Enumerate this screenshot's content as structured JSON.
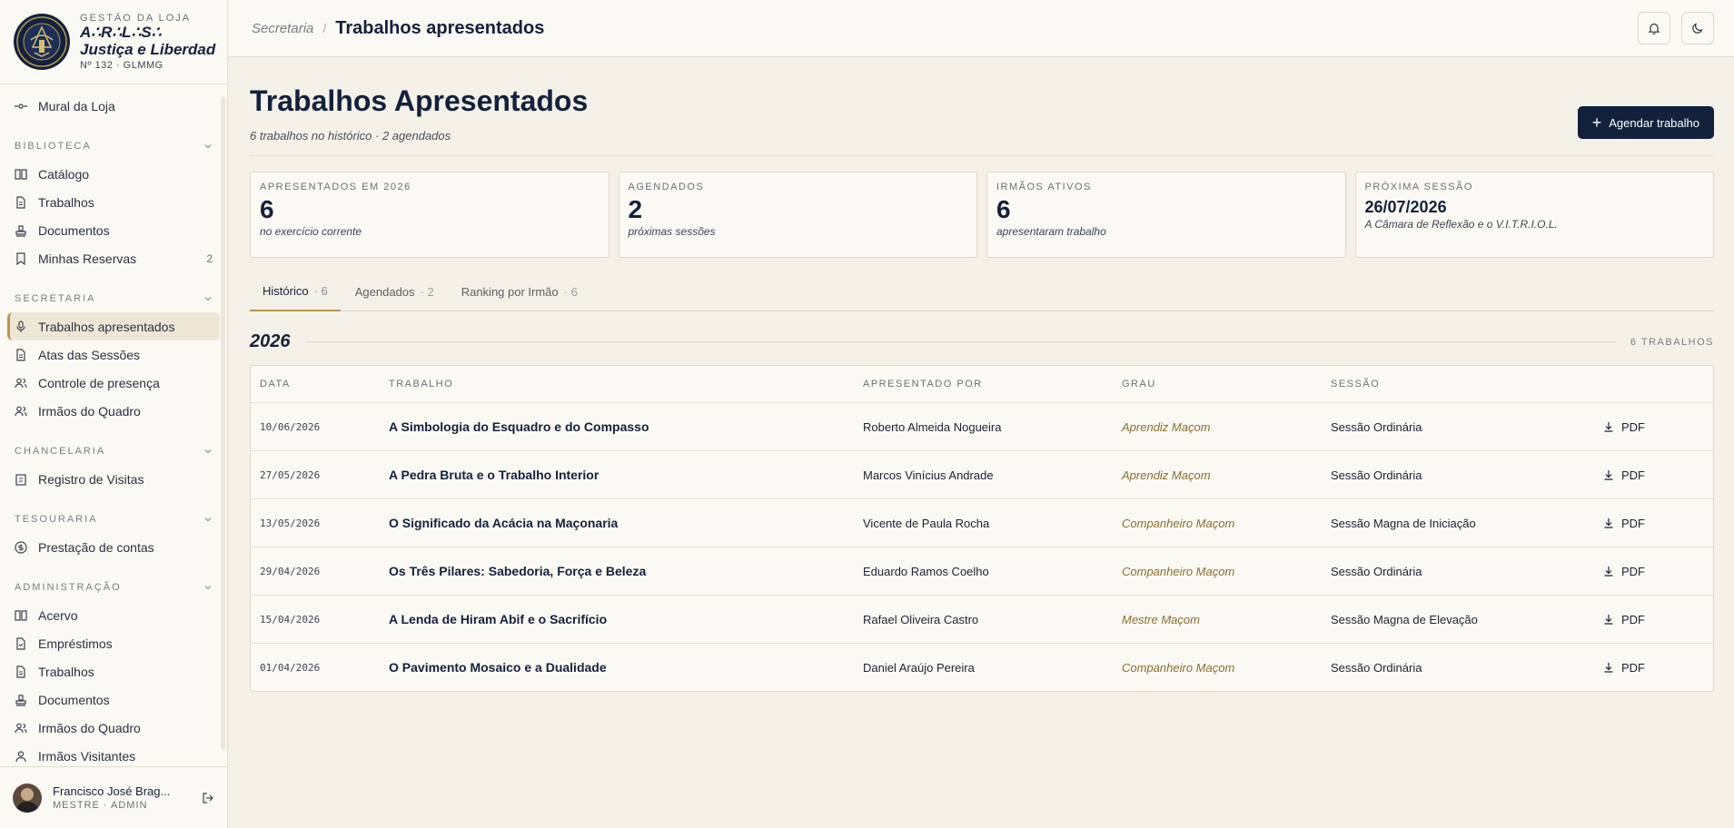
{
  "brand": {
    "kicker": "GESTÃO DA LOJA",
    "line1": "A∴R∴L∴S∴",
    "line2": "Justiça e Liberdade",
    "number": "Nº 132 · GLMMG"
  },
  "nav": {
    "mural": "Mural da Loja",
    "sections": {
      "biblioteca": "BIBLIOTECA",
      "secretaria": "SECRETARIA",
      "chancelaria": "CHANCELARIA",
      "tesouraria": "TESOURARIA",
      "administracao": "ADMINISTRAÇÃO"
    },
    "biblioteca": {
      "catalogo": "Catálogo",
      "trabalhos": "Trabalhos",
      "documentos": "Documentos",
      "reservas": "Minhas Reservas",
      "reservas_count": "2"
    },
    "secretaria": {
      "trabalhos": "Trabalhos apresentados",
      "atas": "Atas das Sessões",
      "presenca": "Controle de presença",
      "irmaos": "Irmãos do Quadro"
    },
    "chancelaria": {
      "visitas": "Registro de Visitas"
    },
    "tesouraria": {
      "contas": "Prestação de contas"
    },
    "administracao": {
      "acervo": "Acervo",
      "emprestimos": "Empréstimos",
      "trabalhos": "Trabalhos",
      "documentos": "Documentos",
      "irmaos": "Irmãos do Quadro",
      "visitantes": "Irmãos Visitantes"
    }
  },
  "user": {
    "name": "Francisco José Brag...",
    "role": "MESTRE · ADMIN"
  },
  "topbar": {
    "parent": "Secretaria",
    "separator": "/",
    "current": "Trabalhos apresentados"
  },
  "page": {
    "title": "Trabalhos Apresentados",
    "subtitle": "6 trabalhos no histórico · 2 agendados",
    "action": "Agendar trabalho"
  },
  "stats": [
    {
      "label": "APRESENTADOS EM 2026",
      "value": "6",
      "note": "no exercício corrente"
    },
    {
      "label": "AGENDADOS",
      "value": "2",
      "note": "próximas sessões"
    },
    {
      "label": "IRMÃOS ATIVOS",
      "value": "6",
      "note": "apresentaram trabalho"
    },
    {
      "label": "PRÓXIMA SESSÃO",
      "value": "26/07/2026",
      "note": "A Câmara de Reflexão e o V.I.T.R.I.O.L."
    }
  ],
  "tabs": [
    {
      "label": "Histórico",
      "count": "· 6"
    },
    {
      "label": "Agendados",
      "count": "· 2"
    },
    {
      "label": "Ranking por Irmão",
      "count": "· 6"
    }
  ],
  "group": {
    "year": "2026",
    "count": "6 TRABALHOS"
  },
  "table": {
    "headers": {
      "date": "DATA",
      "title": "TRABALHO",
      "by": "APRESENTADO POR",
      "grau": "GRAU",
      "sessao": "SESSÃO"
    },
    "pdf_label": "PDF",
    "rows": [
      {
        "date": "10/06/2026",
        "title": "A Simbologia do Esquadro e do Compasso",
        "by": "Roberto Almeida Nogueira",
        "grau": "Aprendiz Maçom",
        "sessao": "Sessão Ordinária"
      },
      {
        "date": "27/05/2026",
        "title": "A Pedra Bruta e o Trabalho Interior",
        "by": "Marcos Vinícius Andrade",
        "grau": "Aprendiz Maçom",
        "sessao": "Sessão Ordinária"
      },
      {
        "date": "13/05/2026",
        "title": "O Significado da Acácia na Maçonaria",
        "by": "Vicente de Paula Rocha",
        "grau": "Companheiro Maçom",
        "sessao": "Sessão Magna de Iniciação"
      },
      {
        "date": "29/04/2026",
        "title": "Os Três Pilares: Sabedoria, Força e Beleza",
        "by": "Eduardo Ramos Coelho",
        "grau": "Companheiro Maçom",
        "sessao": "Sessão Ordinária"
      },
      {
        "date": "15/04/2026",
        "title": "A Lenda de Hiram Abif e o Sacrifício",
        "by": "Rafael Oliveira Castro",
        "grau": "Mestre Maçom",
        "sessao": "Sessão Magna de Elevação"
      },
      {
        "date": "01/04/2026",
        "title": "O Pavimento Mosaico e a Dualidade",
        "by": "Daniel Araújo Pereira",
        "grau": "Companheiro Maçom",
        "sessao": "Sessão Ordinária"
      }
    ]
  },
  "colors": {
    "navy": "#14213d",
    "gold": "#b89a4e",
    "grau": "#8a6e2f",
    "background": "#f4f1e8"
  },
  "icons": [
    "lodge-seal-icon",
    "mural-icon",
    "book-icon",
    "file-icon",
    "stamp-icon",
    "bookmark-icon",
    "mic-icon",
    "users-icon",
    "clipboard-icon",
    "coin-icon",
    "check-file-icon",
    "user-icon",
    "bell-icon",
    "moon-icon",
    "plus-icon",
    "download-icon",
    "logout-icon",
    "chevron-down-icon"
  ]
}
